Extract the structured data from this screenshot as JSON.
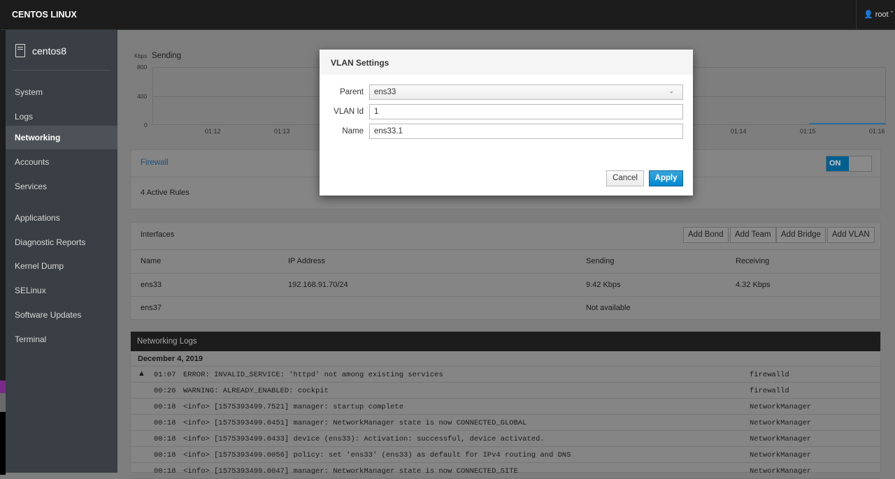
{
  "topbar": {
    "brand": "CENTOS LINUX",
    "user": "root",
    "user_icon": "user-icon"
  },
  "sidebar": {
    "host": "centos8",
    "items": [
      {
        "label": "System"
      },
      {
        "label": "Logs"
      },
      {
        "label": "Networking",
        "active": true
      },
      {
        "label": "Accounts"
      },
      {
        "label": "Services"
      },
      {
        "label": "Applications"
      },
      {
        "label": "Diagnostic Reports"
      },
      {
        "label": "Kernel Dump"
      },
      {
        "label": "SELinux"
      },
      {
        "label": "Software Updates"
      },
      {
        "label": "Terminal"
      }
    ]
  },
  "chart": {
    "unit": "Kbps",
    "title": "Sending",
    "yticks": [
      "800",
      "400",
      "0"
    ],
    "xticks_left": [
      "01:12",
      "01:13"
    ],
    "xticks_right": [
      "01:14",
      "01:15",
      "01:16"
    ],
    "series_color": "#2a7ab0"
  },
  "firewall": {
    "title": "Firewall",
    "toggle": "ON",
    "rules": "4 Active Rules",
    "accent": "#0088ce"
  },
  "interfaces": {
    "title": "Interfaces",
    "buttons": [
      "Add Bond",
      "Add Team",
      "Add Bridge",
      "Add VLAN"
    ],
    "columns": [
      "Name",
      "IP Address",
      "Sending",
      "Receiving"
    ],
    "rows": [
      [
        "ens33",
        "192.168.91.70/24",
        "9.42 Kbps",
        "4.32 Kbps"
      ],
      [
        "ens37",
        "",
        "Not available",
        ""
      ]
    ]
  },
  "logs": {
    "title": "Networking Logs",
    "date": "December 4, 2019",
    "entries": [
      {
        "time": "01:07",
        "msg": "ERROR: INVALID_SERVICE: 'httpd' not among existing services",
        "src": "firewalld",
        "warn": true
      },
      {
        "time": "00:26",
        "msg": "WARNING: ALREADY_ENABLED: cockpit",
        "src": "firewalld"
      },
      {
        "time": "00:18",
        "msg": "<info> [1575393499.7521] manager: startup complete",
        "src": "NetworkManager"
      },
      {
        "time": "00:18",
        "msg": "<info> [1575393499.0451] manager: NetworkManager state is now CONNECTED_GLOBAL",
        "src": "NetworkManager"
      },
      {
        "time": "00:18",
        "msg": "<info> [1575393499.0433] device (ens33): Activation: successful, device activated.",
        "src": "NetworkManager"
      },
      {
        "time": "00:18",
        "msg": "<info> [1575393499.0056] policy: set 'ens33' (ens33) as default for IPv4 routing and DNS",
        "src": "NetworkManager"
      },
      {
        "time": "00:18",
        "msg": "<info> [1575393499.0047] manager: NetworkManager state is now CONNECTED_SITE",
        "src": "NetworkManager"
      }
    ]
  },
  "modal": {
    "title": "VLAN Settings",
    "parent_label": "Parent",
    "parent_value": "ens33",
    "vlan_label": "VLAN Id",
    "vlan_value": "1",
    "name_label": "Name",
    "name_value": "ens33.1",
    "cancel": "Cancel",
    "apply": "Apply",
    "apply_color": "#0088ce"
  }
}
